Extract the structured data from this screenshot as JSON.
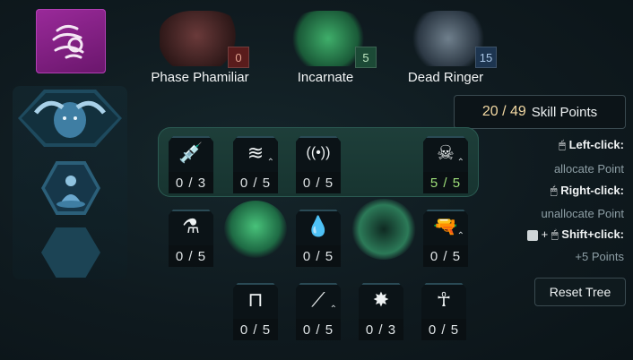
{
  "classes": [
    {
      "name": "Phase Phamiliar",
      "points": "0",
      "badge_color": "#5a1c1c",
      "text_color": "#e3a28f"
    },
    {
      "name": "Incarnate",
      "points": "5",
      "badge_color": "#1c4a36",
      "text_color": "#bfe7c2"
    },
    {
      "name": "Dead Ringer",
      "points": "15",
      "badge_color": "#1d3550",
      "text_color": "#a9c6e6"
    }
  ],
  "skill_points": {
    "value": "20 / 49",
    "label": "Skill Points"
  },
  "instructions": {
    "left_click_key": "Left-click:",
    "left_click_desc": "allocate Point",
    "right_click_key": "Right-click:",
    "right_click_desc": "unallocate Point",
    "shift_click_key": "Shift+click:",
    "shift_click_prefix": "+",
    "shift_click_desc": "+5 Points"
  },
  "reset_button": "Reset Tree",
  "skills": {
    "row1": [
      "0 / 3",
      "0 / 5",
      "0 / 5",
      "5 / 5"
    ],
    "row2": [
      "0 / 5",
      "0 / 5",
      "0 / 5"
    ],
    "row3": [
      "0 / 5",
      "0 / 5",
      "0 / 3",
      "0 / 5"
    ]
  },
  "icons": {
    "syringe": "💉",
    "splash": "≋",
    "signal": "((•))",
    "skull": "☠",
    "vial": "⚗",
    "drop": "💧",
    "gun": "🔫",
    "stamp": "⊓",
    "slash": "⟋",
    "burst": "✸",
    "figure": "🯅"
  },
  "colors": {
    "accent_gold": "#f3d9a3",
    "maxed_green": "#9fe07a",
    "emblem": "#8a208c"
  }
}
